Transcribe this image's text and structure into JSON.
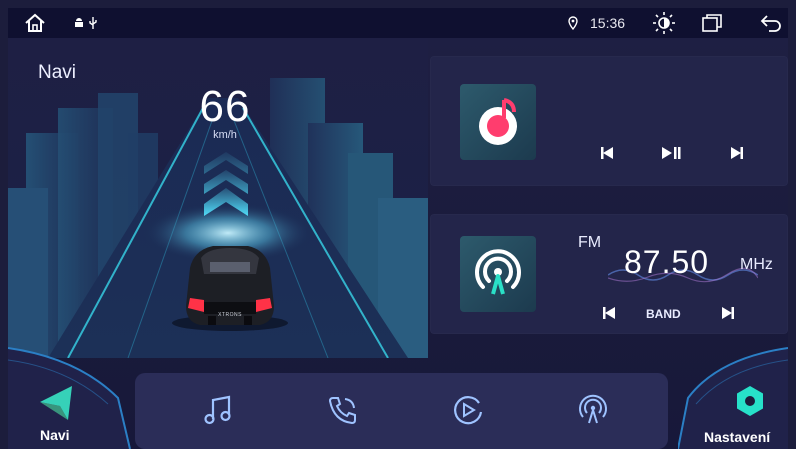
{
  "status_bar": {
    "icons": [
      "home-icon",
      "android-icon",
      "usb-icon",
      "location-pin-icon",
      "brightness-icon",
      "recent-apps-icon",
      "back-icon"
    ],
    "time": "15:36"
  },
  "navi_widget": {
    "title": "Navi",
    "speed": "66",
    "speed_unit": "km/h",
    "car_brand": "XTRONS"
  },
  "music_widget": {
    "icon": "music-note-icon",
    "controls": [
      "previous-icon",
      "play-pause-icon",
      "next-icon"
    ]
  },
  "radio_widget": {
    "icon": "radio-antenna-icon",
    "band_label": "FM",
    "frequency": "87.50",
    "unit": "MHz",
    "band_button": "BAND"
  },
  "dock": {
    "left_app": {
      "label": "Navi",
      "icon": "navigation-arrow-icon"
    },
    "items": [
      "music-icon",
      "phone-icon",
      "video-play-icon",
      "radio-icon"
    ],
    "right_app": {
      "label": "Nastavení",
      "icon": "settings-gear-icon"
    }
  },
  "colors": {
    "background": "#1c1d3c",
    "statusbar": "#0f1030",
    "card": "#23254a",
    "dock": "#2b2d58",
    "accent_teal": "#27e1c9",
    "accent_cyan": "#3fd6ff",
    "music_pink": "#ff3d6e"
  }
}
